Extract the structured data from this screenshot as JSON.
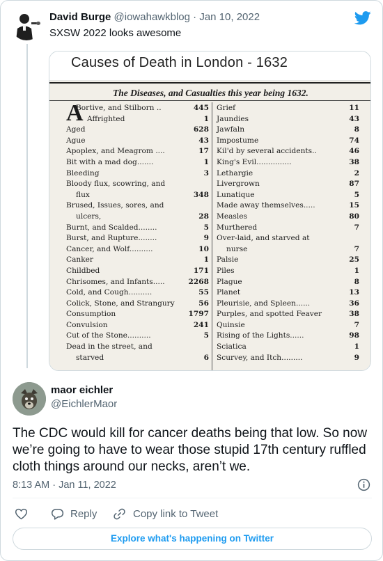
{
  "quoted_tweet": {
    "author_name": "David Burge",
    "author_handle": "@iowahawkblog",
    "separator": "·",
    "date": "Jan 10, 2022",
    "text": "SXSW 2022 looks awesome"
  },
  "media": {
    "title": "Causes of Death in London - 1632",
    "heading": "The Diseases, and Casualties this year being 1632.",
    "left_column": [
      {
        "name": "Bortive, and Stilborn ..",
        "value": "445",
        "style": "indent"
      },
      {
        "name": "Affrighted",
        "value": "1",
        "style": "big-indent"
      },
      {
        "name": "Aged",
        "value": "628"
      },
      {
        "name": "Ague",
        "value": "43"
      },
      {
        "name": "Apoplex, and Meagrom ....",
        "value": "17"
      },
      {
        "name": "Bit with a mad dog.......",
        "value": "1"
      },
      {
        "name": "Bleeding",
        "value": "3"
      },
      {
        "name": "Bloody flux, scowring, and",
        "value": ""
      },
      {
        "name": "flux",
        "value": "348",
        "style": "indent"
      },
      {
        "name": "Brused, Issues, sores, and",
        "value": ""
      },
      {
        "name": "ulcers,",
        "value": "28",
        "style": "indent"
      },
      {
        "name": "Burnt, and Scalded........",
        "value": "5"
      },
      {
        "name": "Burst, and Rupture........",
        "value": "9"
      },
      {
        "name": "Cancer, and Wolf..........",
        "value": "10"
      },
      {
        "name": "Canker",
        "value": "1"
      },
      {
        "name": "Childbed",
        "value": "171"
      },
      {
        "name": "Chrisomes, and Infants.....",
        "value": "2268"
      },
      {
        "name": "Cold, and Cough..........",
        "value": "55"
      },
      {
        "name": "Colick, Stone, and Strangury",
        "value": "56"
      },
      {
        "name": "Consumption",
        "value": "1797"
      },
      {
        "name": "Convulsion",
        "value": "241"
      },
      {
        "name": "Cut of the Stone..........",
        "value": "5"
      },
      {
        "name": "Dead in the street, and",
        "value": ""
      },
      {
        "name": "starved",
        "value": "6",
        "style": "indent"
      }
    ],
    "left_dropcap": "A",
    "right_column": [
      {
        "name": "Grief",
        "value": "11"
      },
      {
        "name": "Jaundies",
        "value": "43"
      },
      {
        "name": "Jawfaln",
        "value": "8"
      },
      {
        "name": "Impostume",
        "value": "74"
      },
      {
        "name": "Kil'd by several accidents..",
        "value": "46"
      },
      {
        "name": "King's Evil...............",
        "value": "38"
      },
      {
        "name": "Lethargie",
        "value": "2"
      },
      {
        "name": "Livergrown",
        "value": "87"
      },
      {
        "name": "Lunatique",
        "value": "5"
      },
      {
        "name": "Made away themselves.....",
        "value": "15"
      },
      {
        "name": "Measles",
        "value": "80"
      },
      {
        "name": "Murthered",
        "value": "7"
      },
      {
        "name": "Over-laid, and starved at",
        "value": ""
      },
      {
        "name": "nurse",
        "value": "7",
        "style": "indent"
      },
      {
        "name": "Palsie",
        "value": "25"
      },
      {
        "name": "Piles",
        "value": "1"
      },
      {
        "name": "Plague",
        "value": "8"
      },
      {
        "name": "Planet",
        "value": "13"
      },
      {
        "name": "Pleurisie, and Spleen......",
        "value": "36"
      },
      {
        "name": "Purples, and spotted Feaver",
        "value": "38"
      },
      {
        "name": "Quinsie",
        "value": "7"
      },
      {
        "name": "Rising of the Lights......",
        "value": "98"
      },
      {
        "name": "Sciatica",
        "value": "1"
      },
      {
        "name": "Scurvey, and Itch.........",
        "value": "9"
      }
    ]
  },
  "reply_tweet": {
    "author_name": "maor eichler",
    "author_handle": "@EichlerMaor",
    "text": "The CDC would kill for cancer deaths being that low. So now we’re going to have to wear those stupid 17th century ruffled cloth things around our necks, aren’t we.",
    "timestamp": "8:13 AM · Jan 11, 2022"
  },
  "actions": {
    "reply_label": "Reply",
    "copy_link_label": "Copy link to Tweet"
  },
  "explore_label": "Explore what's happening on Twitter",
  "colors": {
    "twitter_blue": "#1d9bf0",
    "text_primary": "#0f1419",
    "text_secondary": "#536471",
    "border": "#cfd9de"
  },
  "icons": [
    "twitter-bird-icon",
    "heart-icon",
    "reply-icon",
    "link-icon",
    "info-icon"
  ]
}
